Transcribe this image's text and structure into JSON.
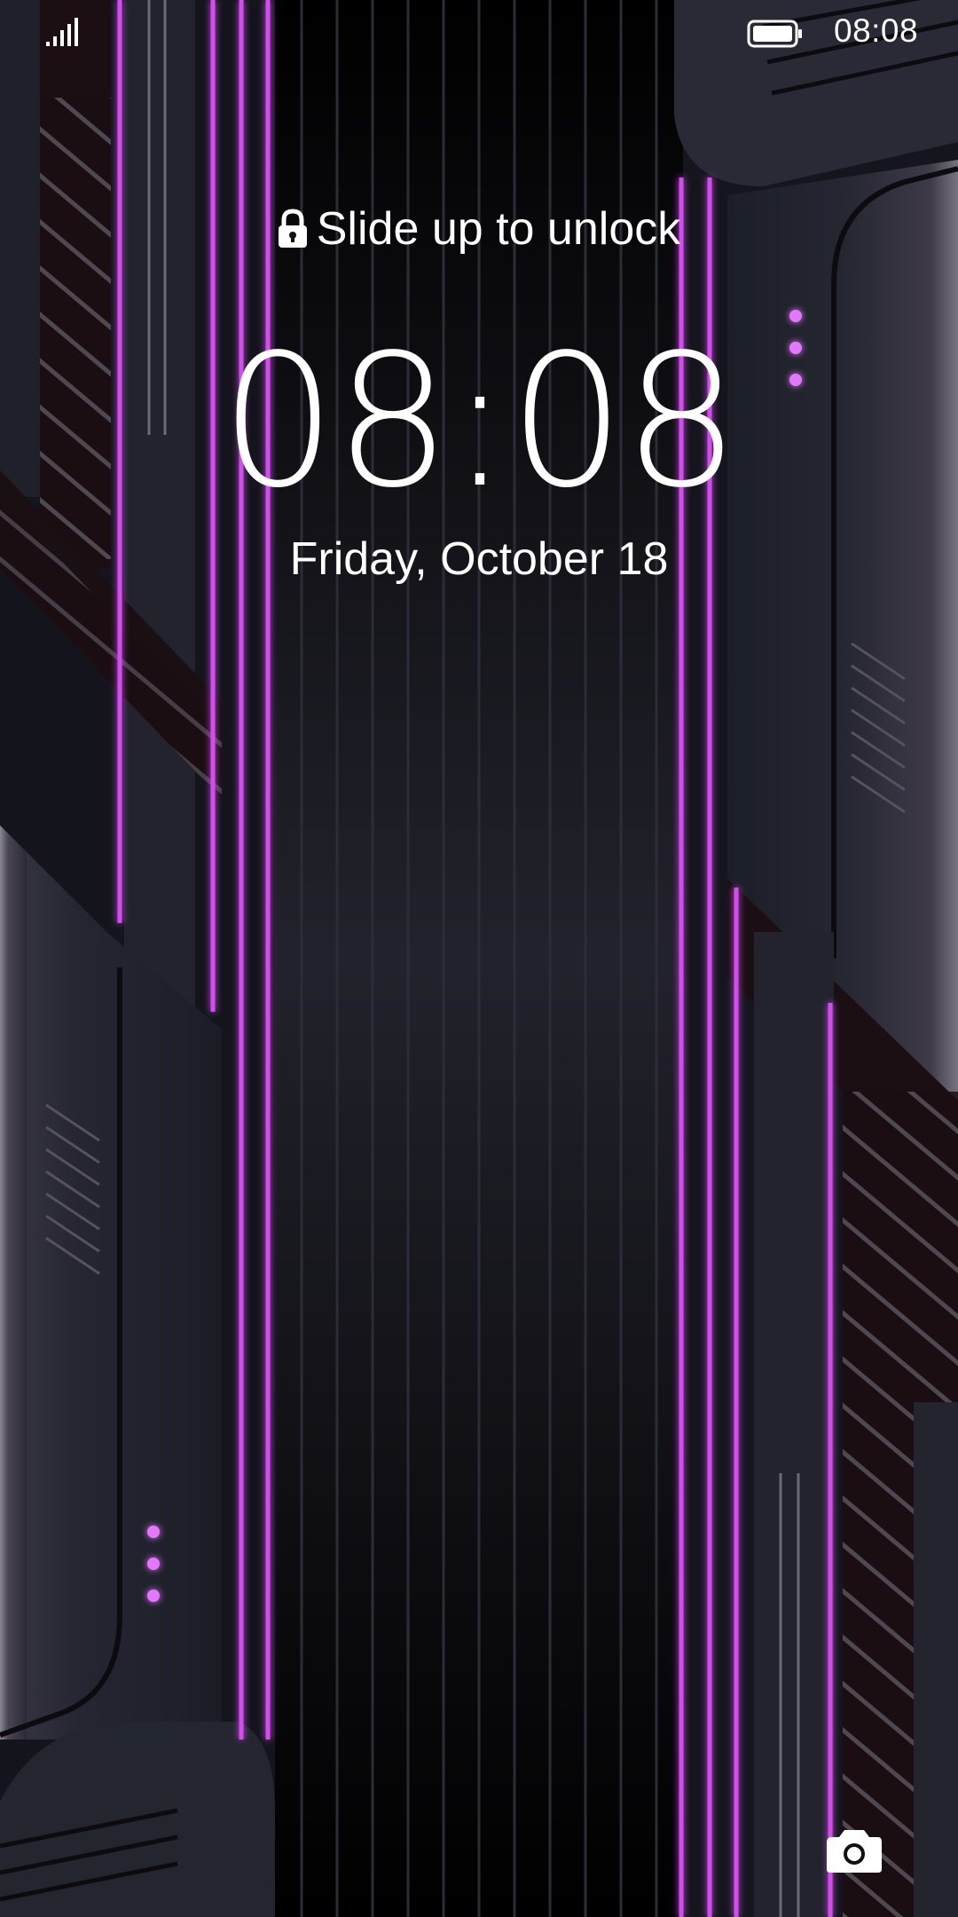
{
  "status_bar": {
    "time": "08:08",
    "battery_icon": "battery-icon",
    "signal_icon": "signal-icon"
  },
  "lock_screen": {
    "unlock_hint": "Slide up to unlock",
    "lock_icon": "lock-icon",
    "time": "08:08",
    "date": "Friday, October 18",
    "camera_icon": "camera-icon"
  },
  "colors": {
    "neon_accent": "#d44cf0",
    "panel_dark": "#1e2029",
    "background": "#050508"
  }
}
